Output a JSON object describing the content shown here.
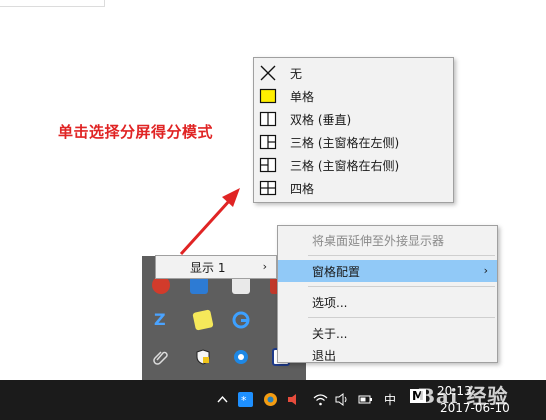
{
  "annotation": {
    "text": "单击选择分屏得分模式"
  },
  "layout_menu": {
    "items": [
      {
        "label": "无",
        "icon": "cross-icon"
      },
      {
        "label": "单格",
        "icon": "single-pane-icon"
      },
      {
        "label": "双格 (垂直)",
        "icon": "two-pane-vertical-icon"
      },
      {
        "label": "三格 (主窗格在左侧)",
        "icon": "three-pane-left-icon"
      },
      {
        "label": "三格 (主窗格在右侧)",
        "icon": "three-pane-right-icon"
      },
      {
        "label": "四格",
        "icon": "four-pane-icon"
      }
    ]
  },
  "context_menu": {
    "extend_display": "将桌面延伸至外接显示器",
    "pane_config": "窗格配置",
    "options": "选项...",
    "about": "关于...",
    "exit": "退出"
  },
  "display_menu": {
    "label": "显示 1"
  },
  "taskbar": {
    "ime": "中",
    "ime_mode": "M",
    "time": "20:13",
    "date": "2017-06-10",
    "watermark": "Bai 经验"
  },
  "colors": {
    "annotation": "#e02424",
    "menu_bg": "#f2f2f2",
    "menu_highlight": "#91c9f7",
    "single_pane_fill": "#ffee00",
    "taskbar_bg": "#1b1b1b"
  }
}
